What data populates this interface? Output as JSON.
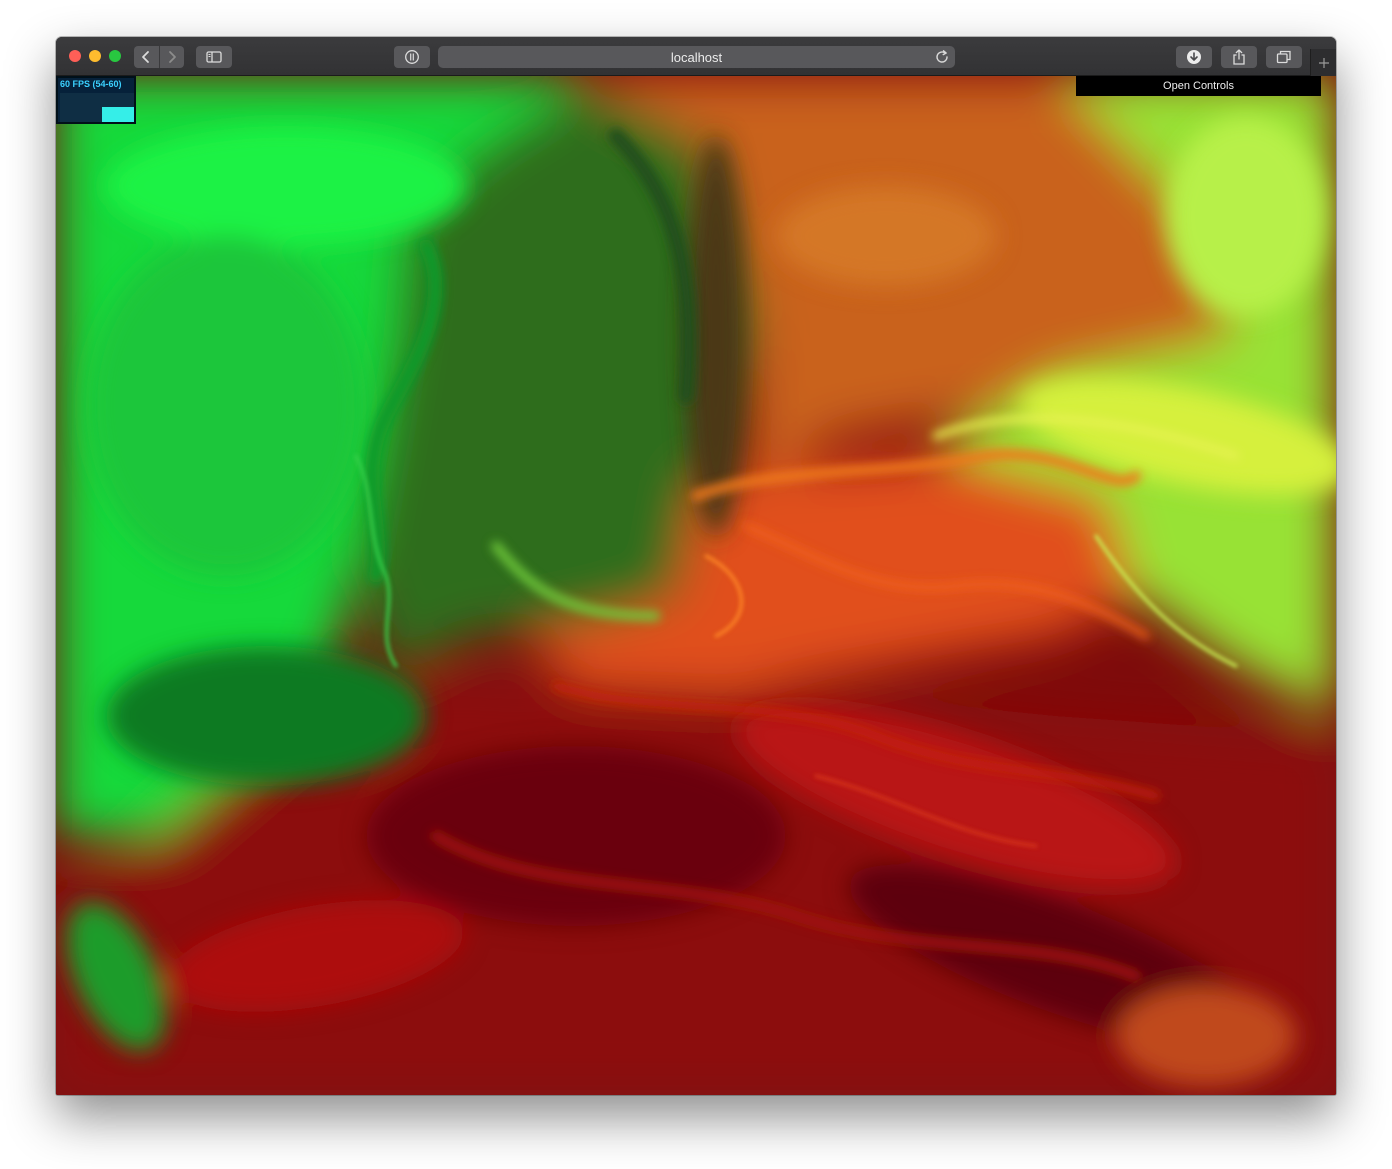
{
  "browser": {
    "address": "localhost"
  },
  "fps_meter": {
    "label": "60 FPS (54-60)",
    "fps": 60,
    "min": 54,
    "max": 60,
    "level": 0.83
  },
  "controls": {
    "open_label": "Open Controls"
  },
  "colors": {
    "fps_text": "#3bd1ff",
    "fps_bar": "#35eee8",
    "fluid_green": "#16ee3c",
    "fluid_red": "#8e0a0a",
    "fluid_orange": "#d2651c",
    "fluid_yellow_green": "#b8f03a"
  }
}
